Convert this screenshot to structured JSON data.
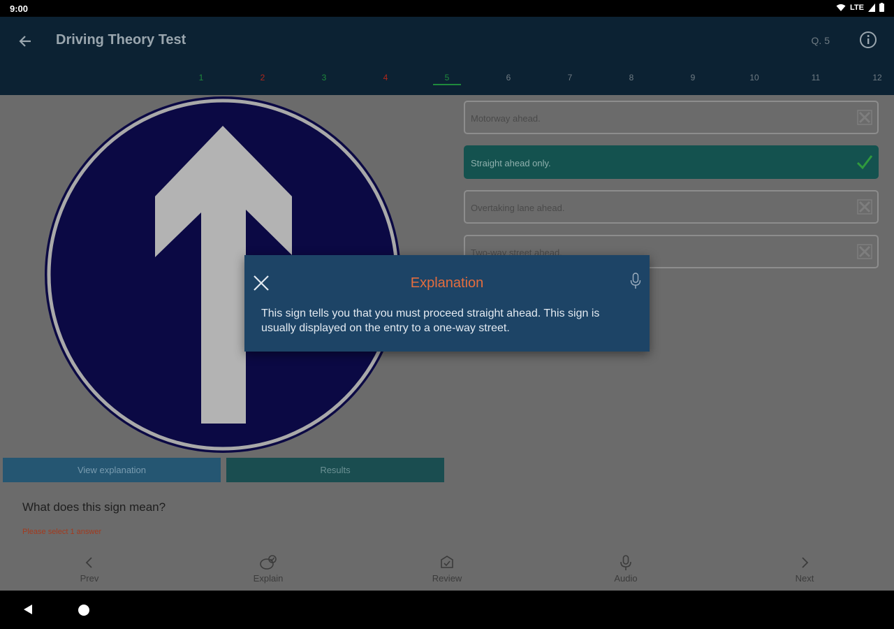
{
  "status_bar": {
    "time": "9:00",
    "network": "LTE"
  },
  "app_bar": {
    "title": "Driving Theory Test",
    "question_number": "Q. 5",
    "question_tabs": [
      {
        "label": "1",
        "state": "correct"
      },
      {
        "label": "2",
        "state": "wrong"
      },
      {
        "label": "3",
        "state": "correct"
      },
      {
        "label": "4",
        "state": "wrong"
      },
      {
        "label": "5",
        "state": "current"
      },
      {
        "label": "6",
        "state": "unanswered"
      },
      {
        "label": "7",
        "state": "unanswered"
      },
      {
        "label": "8",
        "state": "unanswered"
      },
      {
        "label": "9",
        "state": "unanswered"
      },
      {
        "label": "10",
        "state": "unanswered"
      },
      {
        "label": "11",
        "state": "unanswered"
      },
      {
        "label": "12",
        "state": "unanswered"
      }
    ]
  },
  "answers": [
    {
      "text": "Motorway ahead.",
      "mark": "cross-icon",
      "selected": false
    },
    {
      "text": "Straight ahead only.",
      "mark": "check-icon",
      "selected": true
    },
    {
      "text": "Overtaking lane ahead.",
      "mark": "cross-icon",
      "selected": false
    },
    {
      "text": "Two-way street ahead.",
      "mark": "cross-icon",
      "selected": false
    }
  ],
  "actions": {
    "view_explanation": "View explanation",
    "results": "Results"
  },
  "question": {
    "text": "What does this sign mean?",
    "hint": "Please select 1 answer"
  },
  "bottom_nav": {
    "prev": "Prev",
    "explain": "Explain",
    "review": "Review",
    "audio": "Audio",
    "next": "Next"
  },
  "dialog": {
    "title": "Explanation",
    "body": "This sign tells you that you must proceed straight ahead. This sign is usually displayed on the entry to a one-way street."
  },
  "colors": {
    "app_bar": "#0c2233",
    "selected_answer": "#14524f",
    "dialog_bg": "#1d4466",
    "dialog_title": "#e46d3e",
    "sign_blue": "#0b0944"
  }
}
